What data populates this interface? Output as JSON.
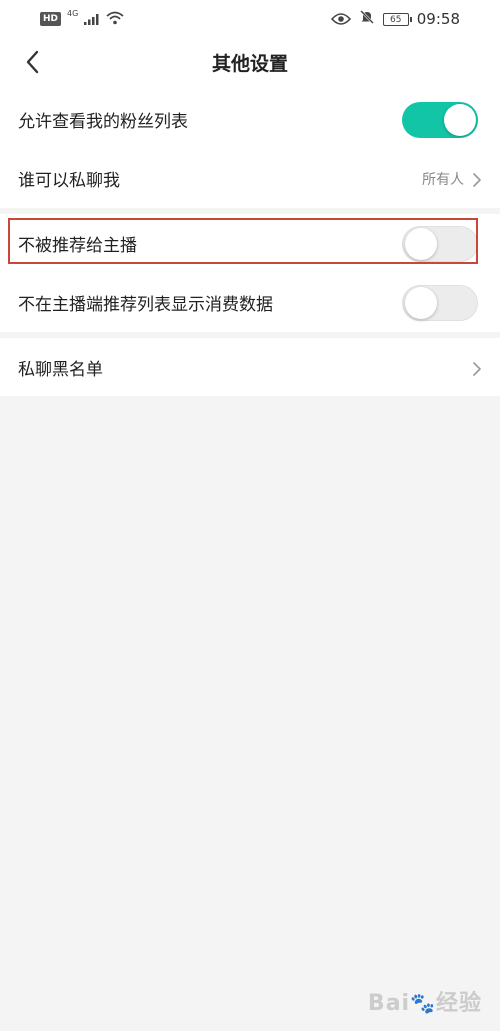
{
  "status_bar": {
    "hd": "HD",
    "network": "4G",
    "battery": "65",
    "time": "09:58"
  },
  "nav": {
    "title": "其他设置"
  },
  "settings": {
    "fans_list": {
      "label": "允许查看我的粉丝列表",
      "state": "on"
    },
    "private_chat": {
      "label": "谁可以私聊我",
      "value": "所有人"
    },
    "not_recommend": {
      "label": "不被推荐给主播",
      "state": "off"
    },
    "hide_consumption": {
      "label": "不在主播端推荐列表显示消费数据",
      "state": "off"
    },
    "blacklist": {
      "label": "私聊黑名单"
    }
  },
  "watermark": {
    "text": "Bai",
    "suffix": "经验"
  },
  "colors": {
    "accent": "#11c5a6",
    "highlight": "#c9473a",
    "background": "#f4f4f4"
  },
  "icons": [
    "back-arrow-icon",
    "chevron-right-icon",
    "eye-icon",
    "bell-muted-icon",
    "wifi-icon",
    "signal-icon",
    "battery-icon"
  ]
}
